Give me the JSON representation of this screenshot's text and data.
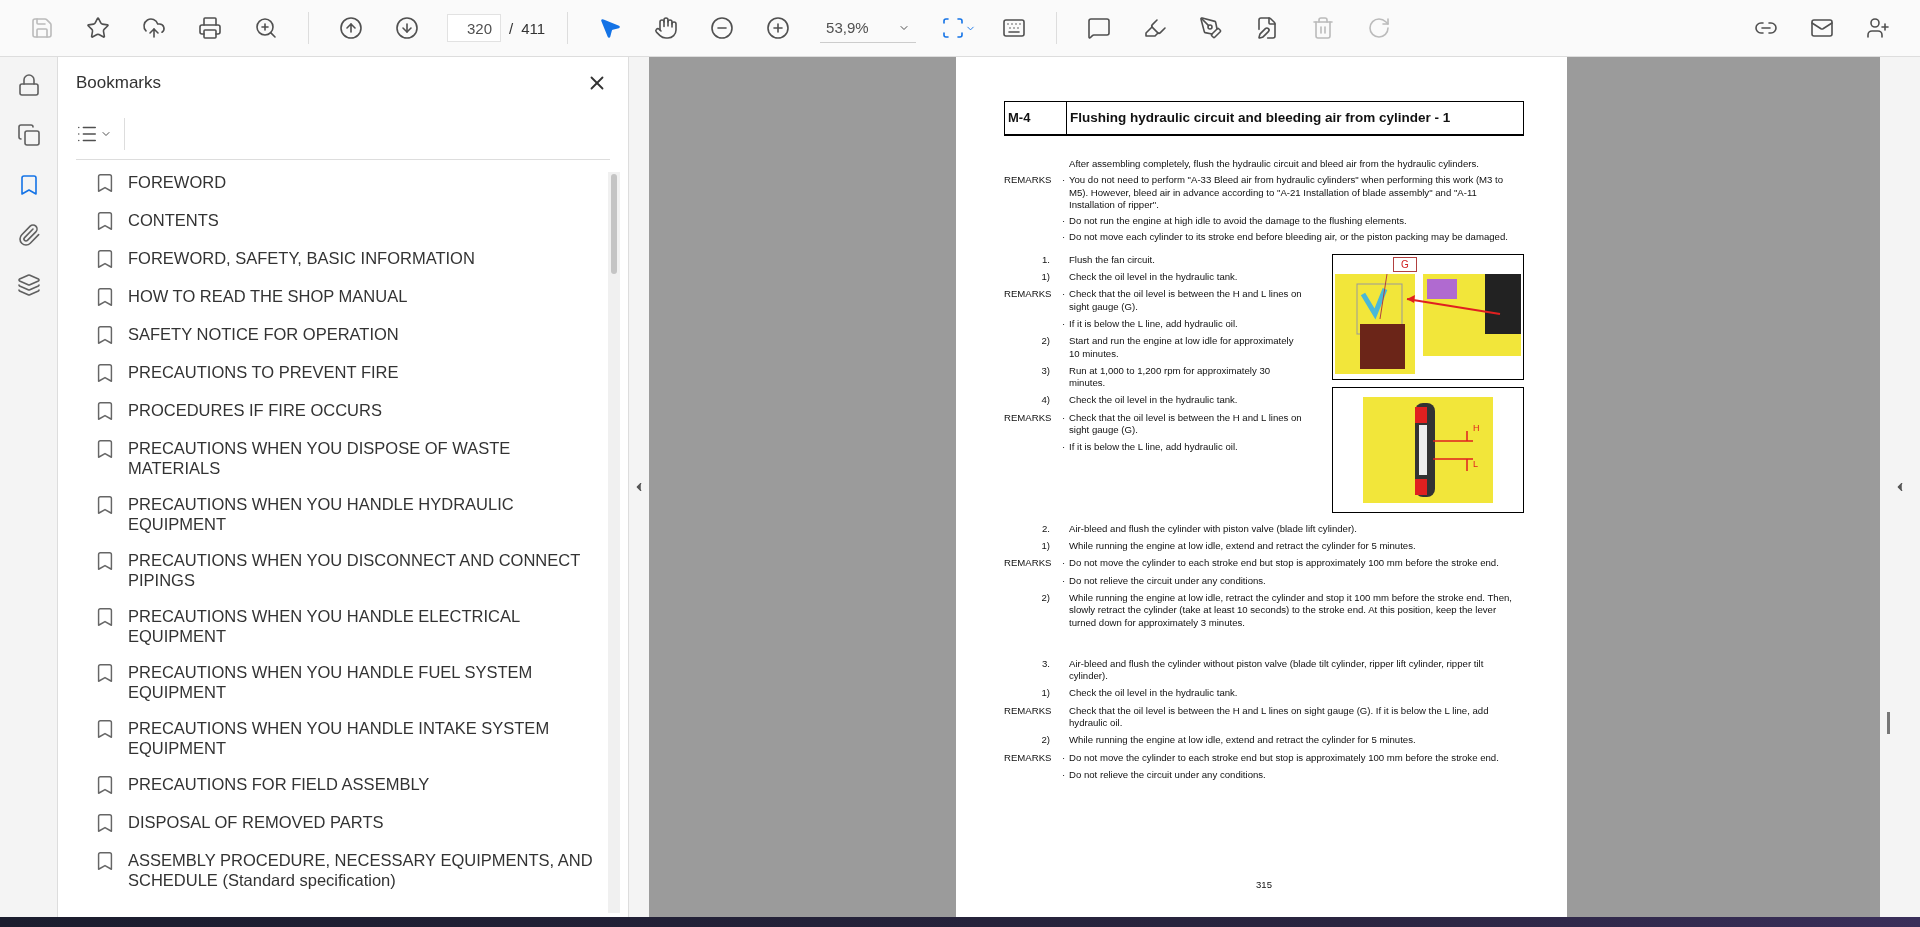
{
  "toolbar": {
    "actions": [
      {
        "kind": "save",
        "disabled": true
      },
      {
        "kind": "star",
        "disabled": false
      },
      {
        "kind": "upload",
        "disabled": false
      },
      {
        "kind": "print",
        "disabled": false
      },
      {
        "kind": "find",
        "disabled": false
      }
    ],
    "page_current": "320",
    "page_separator": "/",
    "page_total": "411",
    "tools": [
      {
        "kind": "select",
        "selected": true
      },
      {
        "kind": "hand",
        "selected": false
      }
    ],
    "zoom": "53,9%",
    "edit_actions": [
      {
        "kind": "comment",
        "disabled": false
      },
      {
        "kind": "highlight",
        "disabled": false
      },
      {
        "kind": "sign",
        "disabled": false
      },
      {
        "kind": "fill",
        "disabled": false
      },
      {
        "kind": "delete",
        "disabled": true
      },
      {
        "kind": "redo",
        "disabled": true
      }
    ]
  },
  "nav_rail": [
    {
      "kind": "lock",
      "selected": false
    },
    {
      "kind": "pages",
      "selected": false
    },
    {
      "kind": "bookmarks",
      "selected": true
    },
    {
      "kind": "attachments",
      "selected": false
    },
    {
      "kind": "layers",
      "selected": false
    }
  ],
  "bookmarks": {
    "title": "Bookmarks",
    "items": [
      {
        "label": "FOREWORD"
      },
      {
        "label": "CONTENTS"
      },
      {
        "label": "FOREWORD, SAFETY, BASIC INFORMATION"
      },
      {
        "label": "HOW TO READ THE SHOP MANUAL"
      },
      {
        "label": "SAFETY NOTICE FOR OPERATION"
      },
      {
        "label": "PRECAUTIONS TO PREVENT FIRE"
      },
      {
        "label": "PROCEDURES IF FIRE OCCURS"
      },
      {
        "label": "PRECAUTIONS WHEN YOU DISPOSE OF WASTE MATERIALS"
      },
      {
        "label": "PRECAUTIONS WHEN YOU HANDLE HYDRAULIC EQUIPMENT"
      },
      {
        "label": "PRECAUTIONS WHEN YOU DISCONNECT AND CONNECT PIPINGS"
      },
      {
        "label": "PRECAUTIONS WHEN YOU HANDLE ELECTRICAL EQUIPMENT"
      },
      {
        "label": "PRECAUTIONS WHEN YOU HANDLE FUEL SYSTEM EQUIPMENT"
      },
      {
        "label": "PRECAUTIONS WHEN YOU HANDLE INTAKE SYSTEM EQUIPMENT"
      },
      {
        "label": "PRECAUTIONS FOR FIELD ASSEMBLY"
      },
      {
        "label": "DISPOSAL OF REMOVED PARTS"
      },
      {
        "label": "ASSEMBLY PROCEDURE, NECESSARY EQUIPMENTS, AND SCHEDULE (Standard specification)"
      }
    ]
  },
  "document": {
    "code": "M-4",
    "title": "Flushing hydraulic circuit and bleeding air from cylinder - 1",
    "blocks_top": [
      {
        "text": "After assembling completely, flush the hydraulic circuit and bleed air from the hydraulic cylinders."
      },
      {
        "label": "REMARKS",
        "bullet": "·",
        "text": "You do not need to perform \"A-33 Bleed air from hydraulic cylinders\" when performing this work (M3 to M5). However, bleed air in advance according to \"A-21 Installation of blade assembly\" and \"A-11 Installation of ripper\"."
      },
      {
        "bullet": "·",
        "text": "Do not run the engine at high idle to avoid the damage to the flushing elements."
      },
      {
        "bullet": "·",
        "text": "Do not move each cylinder to its stroke end before bleeding air, or the piston packing may be damaged."
      }
    ],
    "figure_section": {
      "blocks": [
        {
          "kind": "step",
          "label": "1.",
          "text": "Flush the fan circuit."
        },
        {
          "kind": "step",
          "label": "1)",
          "text": "Check the oil level in the hydraulic tank."
        },
        {
          "label": "REMARKS",
          "bullet": "·",
          "text": "Check that the oil level is between the H and L lines on sight gauge (G)."
        },
        {
          "bullet": "·",
          "text": "If it is below the L line, add hydraulic oil."
        },
        {
          "kind": "step",
          "label": "2)",
          "text": "Start and run the engine at low idle for approximately 10 minutes."
        },
        {
          "kind": "step",
          "label": "3)",
          "text": "Run at 1,000 to 1,200 rpm for approximately 30 minutes."
        },
        {
          "kind": "step",
          "label": "4)",
          "text": "Check the oil level in the hydraulic tank."
        },
        {
          "label": "REMARKS",
          "bullet": "·",
          "text": "Check that the oil level is between the H and L lines on sight gauge (G)."
        },
        {
          "bullet": "·",
          "text": "If it is below the L line, add hydraulic oil."
        }
      ],
      "figures": [
        {
          "kind": "location",
          "callout": "G"
        },
        {
          "kind": "gauge",
          "high": "H",
          "low": "L"
        }
      ]
    },
    "blocks_bottom": [
      {
        "kind": "step",
        "label": "2.",
        "text": "Air-bleed and flush the cylinder with piston valve (blade lift cylinder)."
      },
      {
        "kind": "step",
        "label": "1)",
        "text": "While running the engine at low idle, extend and retract the cylinder for 5 minutes."
      },
      {
        "label": "REMARKS",
        "bullet": "·",
        "text": "Do not move the cylinder to each stroke end but stop is approximately 100 mm before the stroke end."
      },
      {
        "bullet": "·",
        "text": "Do not relieve the circuit under any conditions."
      },
      {
        "kind": "step",
        "label": "2)",
        "text": "While running the engine at low idle, retract the cylinder and stop it 100 mm before the stroke end. Then, slowly retract the cylinder (take at least 10 seconds) to the stroke end. At this position, keep the lever turned down for approximately 3 minutes."
      },
      {
        "kind": "step",
        "label": "3.",
        "text": "Air-bleed and flush the cylinder without piston valve (blade tilt cylinder, ripper lift cylinder, ripper tilt cylinder).",
        "spaced": true
      },
      {
        "kind": "step",
        "label": "1)",
        "text": "Check the oil level in the hydraulic tank."
      },
      {
        "label": "REMARKS",
        "text": "Check that the oil level is between the H and L lines on sight gauge (G). If it is below the L line, add hydraulic oil."
      },
      {
        "kind": "step",
        "label": "2)",
        "text": "While running the engine at low idle, extend and retract the cylinder for 5 minutes."
      },
      {
        "label": "REMARKS",
        "bullet": "·",
        "text": "Do not move the cylinder to each stroke end but stop is approximately 100 mm before the stroke end."
      },
      {
        "bullet": "·",
        "text": "Do not relieve the circuit under any conditions."
      }
    ],
    "page_number": "315"
  }
}
